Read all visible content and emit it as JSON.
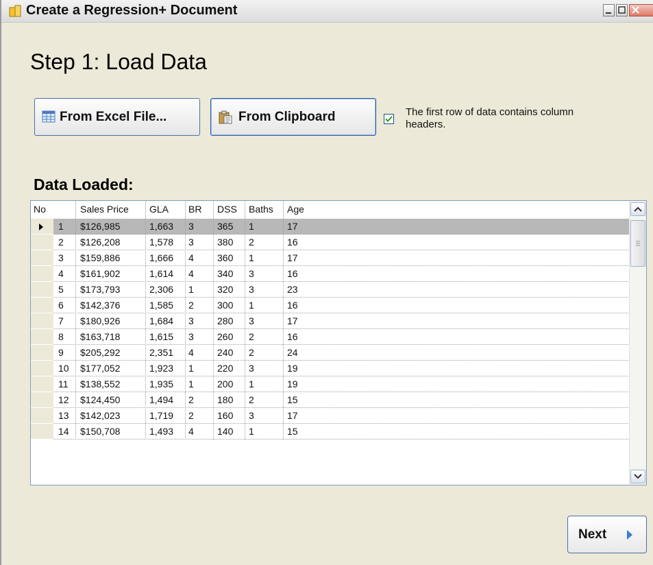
{
  "window": {
    "title": "Create a Regression+ Document"
  },
  "step_title": "Step 1:  Load Data",
  "buttons": {
    "excel": "From Excel File...",
    "clipboard": "From Clipboard",
    "next": "Next"
  },
  "header_checkbox": {
    "checked": true,
    "label": "The first row of data contains column headers."
  },
  "data_loaded_title": "Data Loaded:",
  "grid": {
    "columns": [
      "No",
      "Sales Price",
      "GLA",
      "BR",
      "DSS",
      "Baths",
      "Age"
    ],
    "selected_row": 0,
    "rows": [
      [
        "1",
        "$126,985",
        "1,663",
        "3",
        "365",
        "1",
        "17"
      ],
      [
        "2",
        "$126,208",
        "1,578",
        "3",
        "380",
        "2",
        "16"
      ],
      [
        "3",
        "$159,886",
        "1,666",
        "4",
        "360",
        "1",
        "17"
      ],
      [
        "4",
        "$161,902",
        "1,614",
        "4",
        "340",
        "3",
        "16"
      ],
      [
        "5",
        "$173,793",
        "2,306",
        "1",
        "320",
        "3",
        "23"
      ],
      [
        "6",
        "$142,376",
        "1,585",
        "2",
        "300",
        "1",
        "16"
      ],
      [
        "7",
        "$180,926",
        "1,684",
        "3",
        "280",
        "3",
        "17"
      ],
      [
        "8",
        "$163,718",
        "1,615",
        "3",
        "260",
        "2",
        "16"
      ],
      [
        "9",
        "$205,292",
        "2,351",
        "4",
        "240",
        "2",
        "24"
      ],
      [
        "10",
        "$177,052",
        "1,923",
        "1",
        "220",
        "3",
        "19"
      ],
      [
        "11",
        "$138,552",
        "1,935",
        "1",
        "200",
        "1",
        "19"
      ],
      [
        "12",
        "$124,450",
        "1,494",
        "2",
        "180",
        "2",
        "15"
      ],
      [
        "13",
        "$142,023",
        "1,719",
        "2",
        "160",
        "3",
        "17"
      ],
      [
        "14",
        "$150,708",
        "1,493",
        "4",
        "140",
        "1",
        "15"
      ]
    ]
  },
  "icons": {
    "app": "document-icon",
    "excel": "spreadsheet-icon",
    "clipboard": "clipboard-icon",
    "next": "arrow-right-icon",
    "row_pointer": "row-pointer-icon"
  },
  "colors": {
    "accent": "#2b5aa0",
    "selected_row": "#b8b8b8",
    "next_arrow": "#3a7bd5"
  }
}
